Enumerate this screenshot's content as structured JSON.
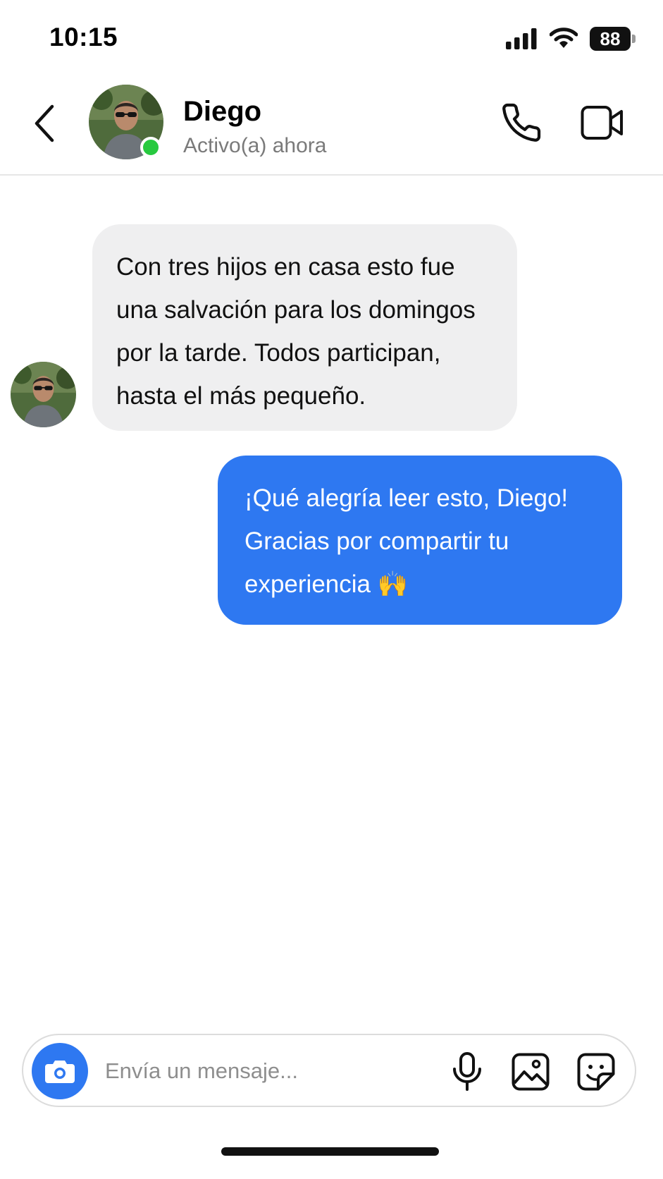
{
  "status_bar": {
    "time": "10:15",
    "battery_level": "88",
    "icons": [
      "signal-icon",
      "wifi-icon",
      "battery-icon"
    ]
  },
  "header": {
    "back_icon": "chevron-left-icon",
    "contact_name": "Diego",
    "contact_status": "Activo(a) ahora",
    "online_color": "#27c93f",
    "call_icon": "phone-icon",
    "video_icon": "video-camera-icon"
  },
  "messages": [
    {
      "direction": "incoming",
      "sender": "Diego",
      "lines": [
        "Con tres hijos en casa esto fue",
        "una salvación para los domingos",
        "por la tarde. Todos participan,",
        "hasta el más pequeño."
      ],
      "bubble_color": "#efeff0"
    },
    {
      "direction": "outgoing",
      "lines": [
        "¡Qué alegría leer esto, Diego!",
        "Gracias por compartir tu",
        "experiencia 🙌"
      ],
      "bubble_color": "#2e78f1"
    }
  ],
  "composer": {
    "placeholder": "Envía un mensaje...",
    "value": "",
    "icons": [
      "camera-icon",
      "microphone-icon",
      "image-icon",
      "sticker-icon"
    ],
    "accent_color": "#2e78f1"
  }
}
